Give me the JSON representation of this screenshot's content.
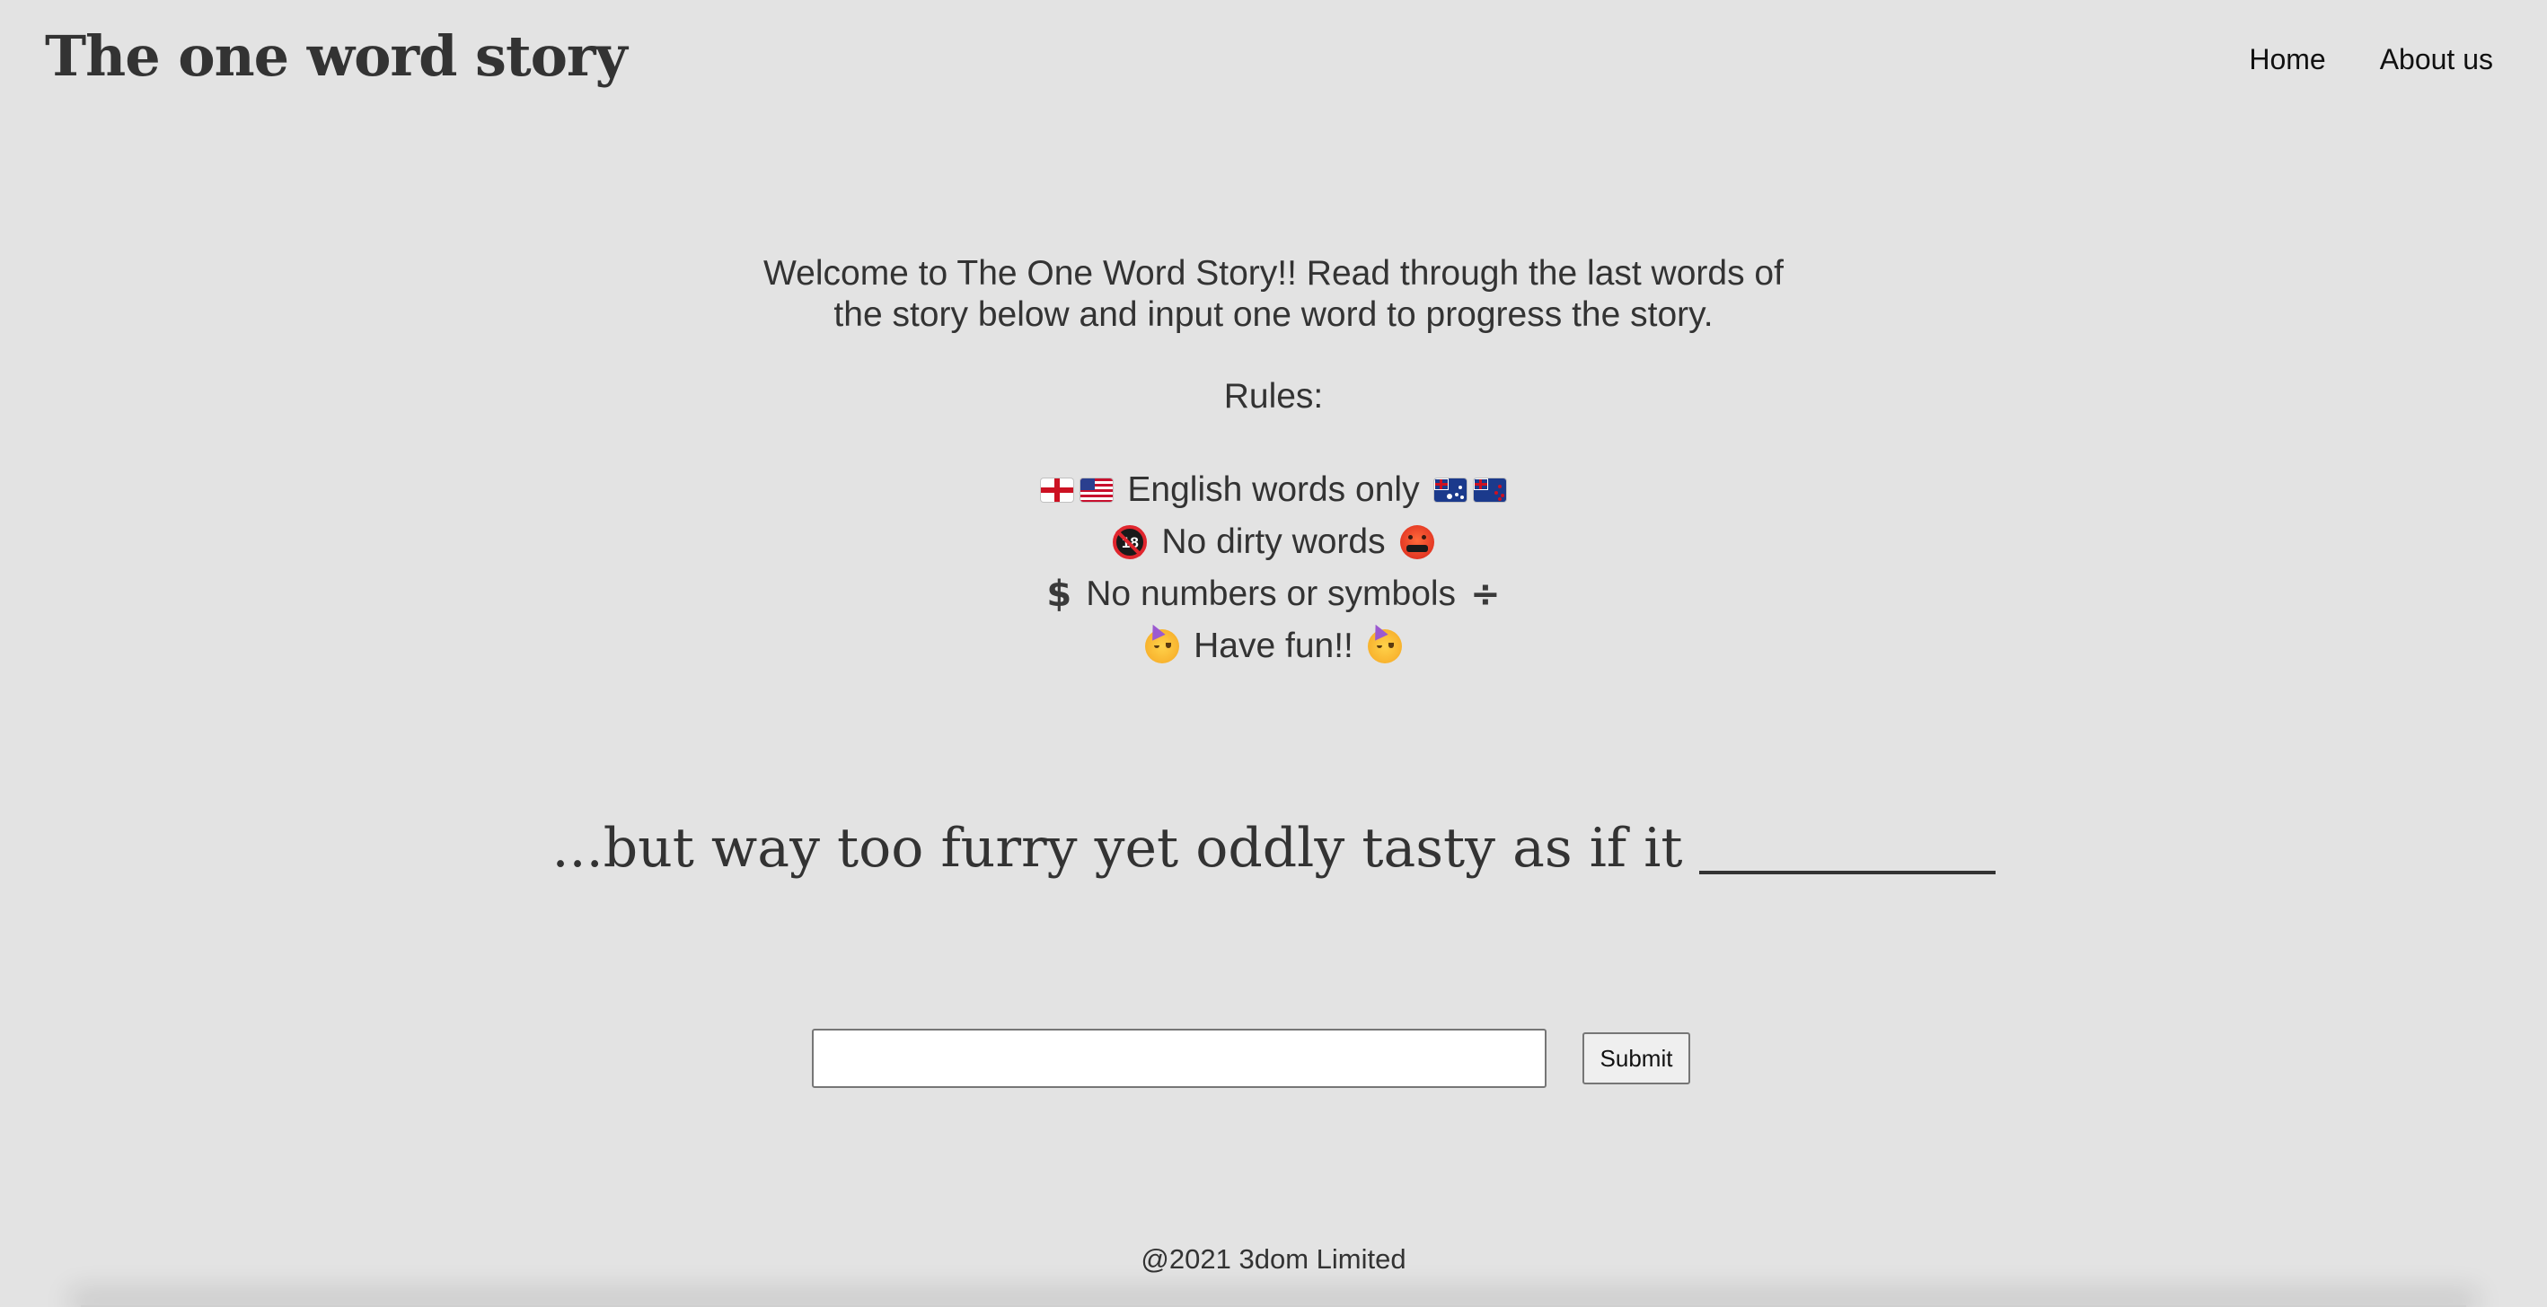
{
  "header": {
    "title": "The one word story",
    "nav": [
      {
        "label": "Home"
      },
      {
        "label": "About us"
      }
    ]
  },
  "intro": {
    "welcome": "Welcome to The One Word Story!! Read through the last words of the story below and input one word to progress the story.",
    "rules_heading": "Rules:",
    "rules": [
      {
        "text": "English words only",
        "left_icons": [
          "england-flag-icon",
          "usa-flag-icon"
        ],
        "right_icons": [
          "australia-flag-icon",
          "new-zealand-flag-icon"
        ]
      },
      {
        "text": "No dirty words",
        "left_icons": [
          "no-under-18-icon"
        ],
        "right_icons": [
          "angry-cursing-face-icon"
        ]
      },
      {
        "text": "No numbers or symbols",
        "left_glyph": "$",
        "right_glyph": "÷"
      },
      {
        "text": "Have fun!!",
        "left_icons": [
          "party-face-icon"
        ],
        "right_icons": [
          "party-face-icon"
        ]
      }
    ],
    "no18_label": "18"
  },
  "story": {
    "last_words": "...but way too furry yet oddly tasty as if it"
  },
  "form": {
    "input_value": "",
    "input_placeholder": "",
    "submit_label": "Submit"
  },
  "footer": {
    "copyright": "@2021 3dom Limited"
  },
  "colors": {
    "background": "#e3e3e3",
    "text": "#333333"
  }
}
